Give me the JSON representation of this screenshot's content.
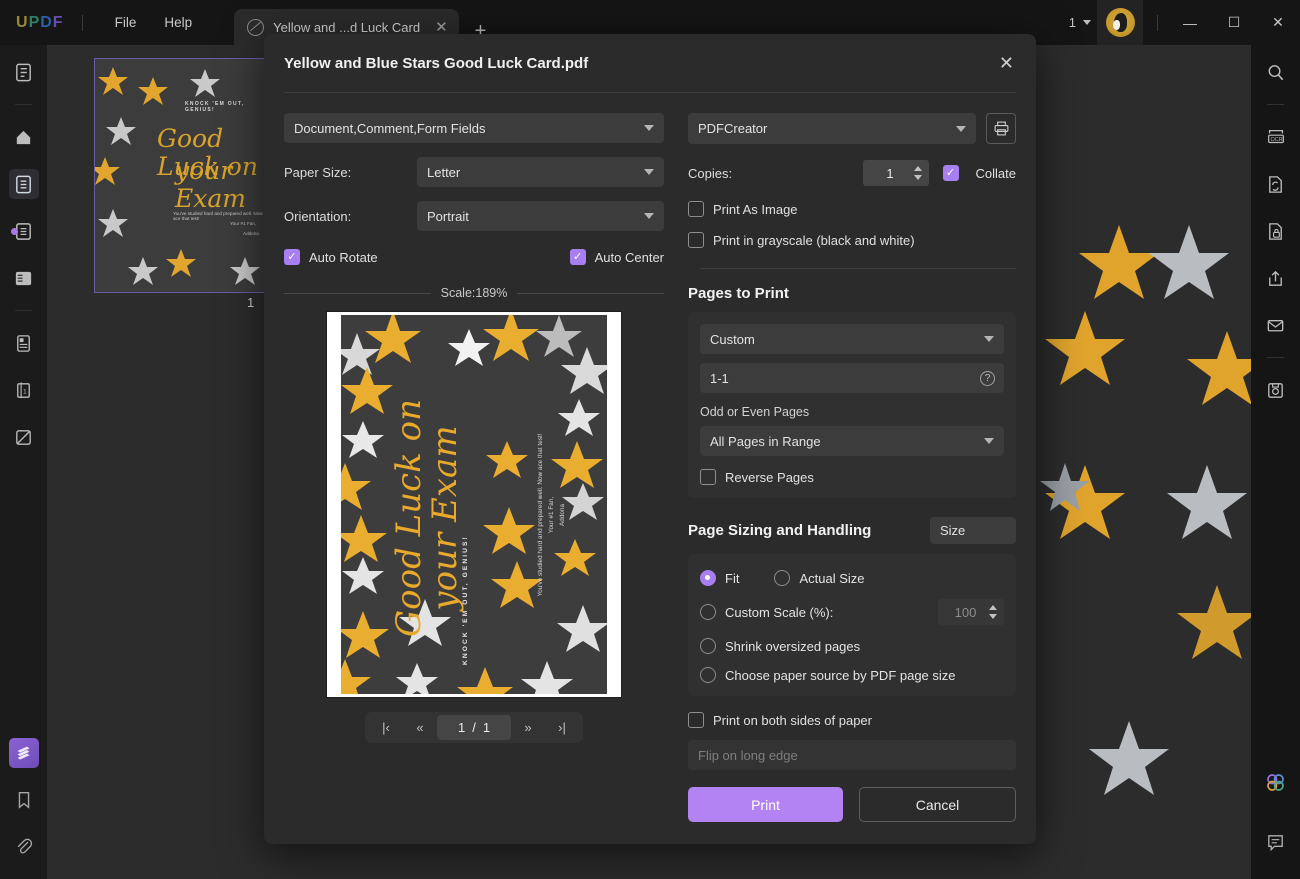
{
  "titlebar": {
    "logo": [
      "U",
      "P",
      "D",
      "F"
    ],
    "menus": [
      {
        "label": "File",
        "name": "menu-file"
      },
      {
        "label": "Help",
        "name": "menu-help"
      }
    ],
    "tab": {
      "label": "Yellow and ...d Luck Card",
      "close": "✕"
    },
    "new_tab": "+",
    "zoom_value": "1",
    "window": {
      "minimize": "—",
      "maximize": "☐",
      "close": "✕"
    }
  },
  "left_rail": {
    "items": [
      {
        "name": "reader-view-icon",
        "label": "Reader View"
      },
      {
        "name": "page-fit-icon",
        "label": "Page Fit"
      },
      {
        "name": "single-page-icon",
        "label": "Single Page View"
      },
      {
        "name": "continuous-scroll-icon",
        "label": "Continuous Scroll"
      },
      {
        "name": "two-page-icon",
        "label": "Two Page View"
      },
      {
        "name": "page-thumbnail-icon",
        "label": "Page Thumbnails"
      },
      {
        "name": "crop-page-icon",
        "label": "Crop Page"
      },
      {
        "name": "separate-page-icon",
        "label": "Separate Pages"
      }
    ],
    "bottom": [
      {
        "name": "layers-icon",
        "label": "Layers"
      },
      {
        "name": "bookmark-icon",
        "label": "Bookmarks"
      },
      {
        "name": "attachment-icon",
        "label": "Attachments"
      }
    ]
  },
  "right_rail": {
    "items": [
      {
        "name": "search-icon",
        "label": "Search"
      },
      {
        "name": "ocr-icon",
        "label": "OCR"
      },
      {
        "name": "convert-pdf-icon",
        "label": "Convert PDF"
      },
      {
        "name": "protect-document-icon",
        "label": "Protect"
      },
      {
        "name": "share-icon",
        "label": "Share"
      },
      {
        "name": "email-icon",
        "label": "Email"
      },
      {
        "name": "save-icon",
        "label": "Save"
      }
    ],
    "bottom": [
      {
        "name": "ai-assistant-icon",
        "label": "AI Assistant"
      },
      {
        "name": "comment-icon",
        "label": "Comment"
      }
    ]
  },
  "workspace": {
    "page_number": "1",
    "card": {
      "eyebrow": "KNOCK 'EM OUT, GENIUS!",
      "line1": "Good Luck on",
      "line2": "your Exam",
      "body1": "You've studied hard and prepared well. Now ace that test!",
      "body2": "Your #1 Fan,",
      "body3": "Addona"
    },
    "ghost_close": "✕"
  },
  "dialog": {
    "title": "Yellow and Blue Stars Good Luck Card.pdf",
    "close": "✕",
    "left": {
      "content_select": "Document,Comment,Form Fields",
      "paper_size_label": "Paper Size:",
      "paper_size_value": "Letter",
      "orientation_label": "Orientation:",
      "orientation_value": "Portrait",
      "auto_rotate_label": "Auto Rotate",
      "auto_rotate_checked": true,
      "auto_center_label": "Auto Center",
      "auto_center_checked": true,
      "scale_text": "Scale:189%",
      "pager": {
        "first": "|‹",
        "prev": "«",
        "current": "1",
        "divider": "/",
        "total": "1",
        "next": "»",
        "last": "›|"
      }
    },
    "right": {
      "printer_value": "PDFCreator",
      "copies_label": "Copies:",
      "copies_value": "1",
      "collate_label": "Collate",
      "collate_checked": true,
      "print_as_image_label": "Print As Image",
      "print_as_image_checked": false,
      "grayscale_label": "Print in grayscale (black and white)",
      "grayscale_checked": false,
      "pages_to_print_title": "Pages to Print",
      "pages_mode": "Custom",
      "pages_range": "1-1",
      "pages_range_help": "?",
      "odd_even_label": "Odd or Even Pages",
      "odd_even_value": "All Pages in Range",
      "reverse_pages_label": "Reverse Pages",
      "reverse_pages_checked": false,
      "sizing_title": "Page Sizing and Handling",
      "size_select": "Size",
      "fit_label": "Fit",
      "fit_selected": true,
      "actual_size_label": "Actual Size",
      "custom_scale_label": "Custom Scale (%):",
      "custom_scale_value": "100",
      "shrink_label": "Shrink oversized pages",
      "paper_source_label": "Choose paper source by PDF page size",
      "both_sides_label": "Print on both sides of paper",
      "both_sides_checked": false,
      "flip_value": "Flip on long edge",
      "print_button": "Print",
      "cancel_button": "Cancel"
    }
  },
  "colors": {
    "accent": "#a97ef0",
    "print_button": "#b483f3",
    "card_gold": "#e8a92c",
    "card_bg": "#3d3d3d"
  }
}
